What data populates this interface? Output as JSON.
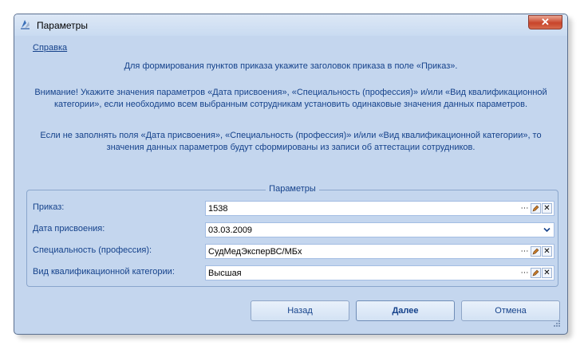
{
  "window": {
    "title": "Параметры",
    "close_label": "✕"
  },
  "help_link": "Справка",
  "messages": {
    "line1": "Для формирования пунктов приказа укажите заголовок приказа в поле «Приказ».",
    "line2a": "Внимание! Укажите значения параметров «Дата присвоения», «Специальность (профессия)» и/или «Вид квалификационной",
    "line2b": "категории», если необходимо всем выбранным сотрудникам установить одинаковые значения данных параметров.",
    "line3a": "Если не заполнять поля «Дата присвоения», «Специальность (профессия)» и/или «Вид квалификационной категории», то",
    "line3b": "значения данных параметров будут сформированы из записи об аттестации сотрудников."
  },
  "group": {
    "title": "Параметры",
    "fields": [
      {
        "label": "Приказ:",
        "value": "1538"
      },
      {
        "label": "Дата присвоения:",
        "value": "03.03.2009"
      },
      {
        "label": "Специальность (профессия):",
        "value": "СудМедЭксперВС/МБх"
      },
      {
        "label": "Вид квалификационной категории:",
        "value": "Высшая"
      }
    ]
  },
  "buttons": {
    "back": "Назад",
    "next": "Далее",
    "cancel": "Отмена"
  },
  "colors": {
    "window_bg": "#c4d6ee",
    "text": "#15428b",
    "close_red": "#c8442a"
  }
}
